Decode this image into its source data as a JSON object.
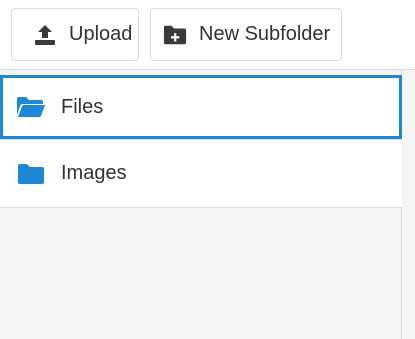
{
  "toolbar": {
    "upload": {
      "label": "Upload",
      "icon": "upload-icon"
    },
    "new_subfolder": {
      "label": "New Subfolder",
      "icon": "folder-plus-icon"
    }
  },
  "folders": [
    {
      "label": "Files",
      "icon": "folder-open-icon",
      "selected": true
    },
    {
      "label": "Images",
      "icon": "folder-icon",
      "selected": false
    }
  ],
  "colors": {
    "accent": "#1e88d7",
    "icon_dark": "#3a3a3a",
    "border": "#dcdcdc",
    "background": "#f5f5f5"
  }
}
